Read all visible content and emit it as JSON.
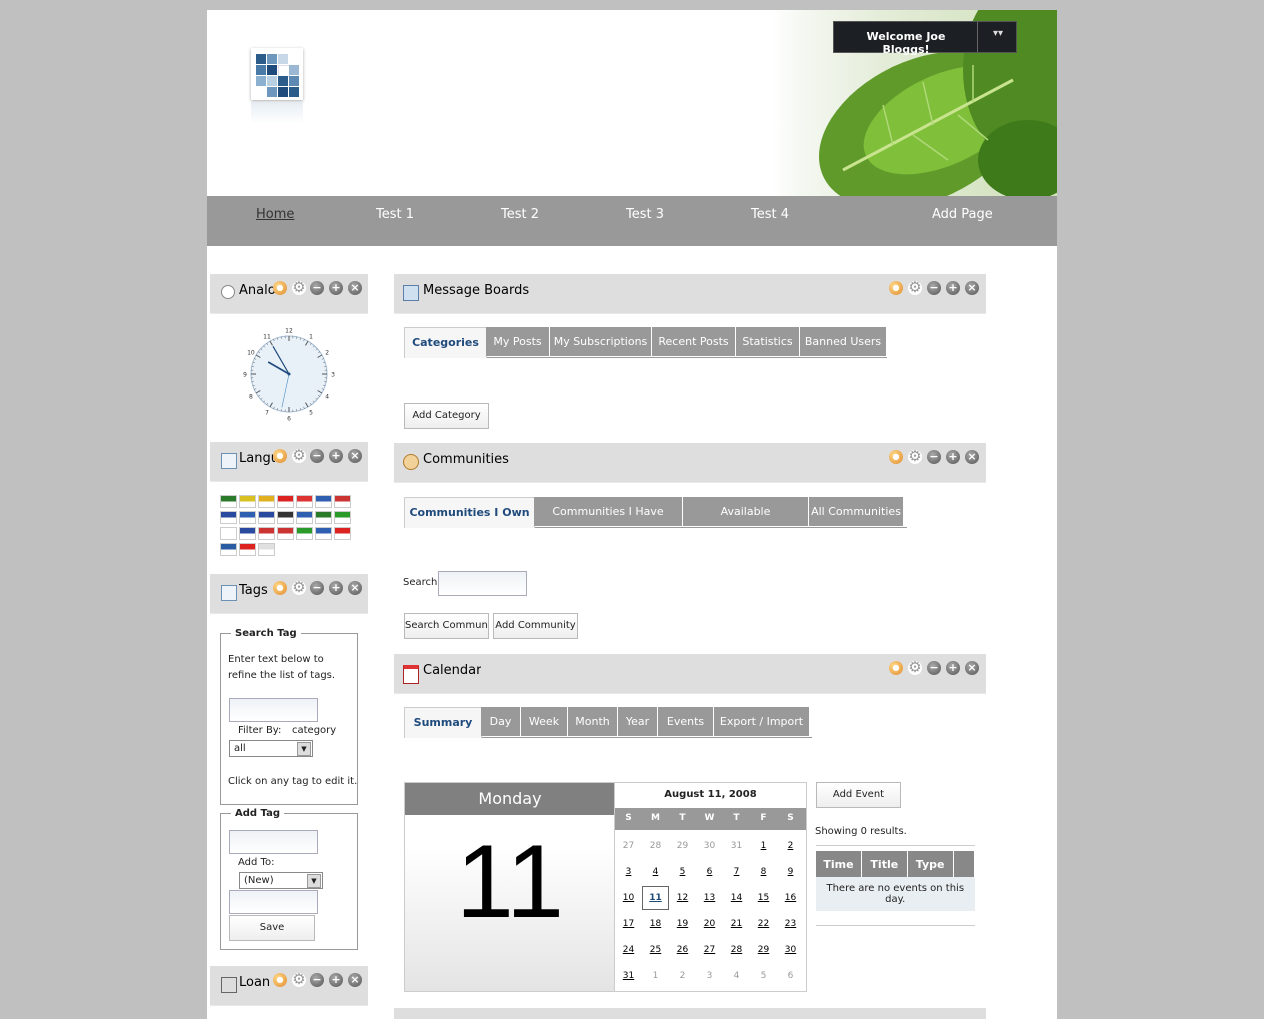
{
  "header": {
    "welcome": "Welcome Joe Bloggs!"
  },
  "nav": {
    "items": [
      "Home",
      "Test 1",
      "Test 2",
      "Test 3",
      "Test 4",
      "Add Page"
    ],
    "active": "Home"
  },
  "portlets": {
    "analog_clock": {
      "title": "Analog Clock",
      "clock_numbers": [
        "12",
        "1",
        "2",
        "3",
        "4",
        "5",
        "6",
        "7",
        "8",
        "9",
        "10",
        "11"
      ]
    },
    "language": {
      "title": "Language"
    },
    "tags": {
      "title": "Tags",
      "search_legend": "Search Tag",
      "search_help": "Enter text below to refine the list of tags.",
      "filter_by_label": "Filter By:",
      "filter_by_value": "category",
      "filter_select_value": "all",
      "click_help": "Click on any tag to edit it.",
      "add_legend": "Add Tag",
      "add_to_label": "Add To:",
      "add_to_value": "(New)",
      "save_label": "Save"
    },
    "loan": {
      "title": "Loan Calculator"
    },
    "message_boards": {
      "title": "Message Boards",
      "tabs": [
        "Categories",
        "My Posts",
        "My Subscriptions",
        "Recent Posts",
        "Statistics",
        "Banned Users"
      ],
      "active_tab": "Categories",
      "add_category": "Add Category"
    },
    "communities": {
      "title": "Communities",
      "tabs": [
        "Communities I Own",
        "Communities I Have Joined",
        "Available Communities",
        "All Communities"
      ],
      "active_tab": "Communities I Own",
      "search_label": "Search",
      "search_value": "",
      "search_button": "Search Communities",
      "add_button": "Add Community"
    },
    "calendar": {
      "title": "Calendar",
      "tabs": [
        "Summary",
        "Day",
        "Week",
        "Month",
        "Year",
        "Events",
        "Export / Import"
      ],
      "active_tab": "Summary",
      "weekday": "Monday",
      "day_number": "11",
      "month_title": "August 11, 2008",
      "dow": [
        "S",
        "M",
        "T",
        "W",
        "T",
        "F",
        "S"
      ],
      "weeks": [
        [
          "27",
          "28",
          "29",
          "30",
          "31",
          "1",
          "2"
        ],
        [
          "3",
          "4",
          "5",
          "6",
          "7",
          "8",
          "9"
        ],
        [
          "10",
          "11",
          "12",
          "13",
          "14",
          "15",
          "16"
        ],
        [
          "17",
          "18",
          "19",
          "20",
          "21",
          "22",
          "23"
        ],
        [
          "24",
          "25",
          "26",
          "27",
          "28",
          "29",
          "30"
        ],
        [
          "31",
          "1",
          "2",
          "3",
          "4",
          "5",
          "6"
        ]
      ],
      "add_event": "Add Event",
      "showing": "Showing 0 results.",
      "columns": [
        "Time",
        "Title",
        "Type"
      ],
      "empty_message": "There are no events on this day."
    }
  },
  "icons": {
    "portlet_controls": [
      "color-scheme-icon",
      "gear-icon",
      "minimize-icon",
      "maximize-icon",
      "close-icon"
    ]
  },
  "colors": {
    "nav_bg": "#999999",
    "tab_active_text": "#1f4a7c",
    "portlet_head_bg": "#dedede"
  }
}
